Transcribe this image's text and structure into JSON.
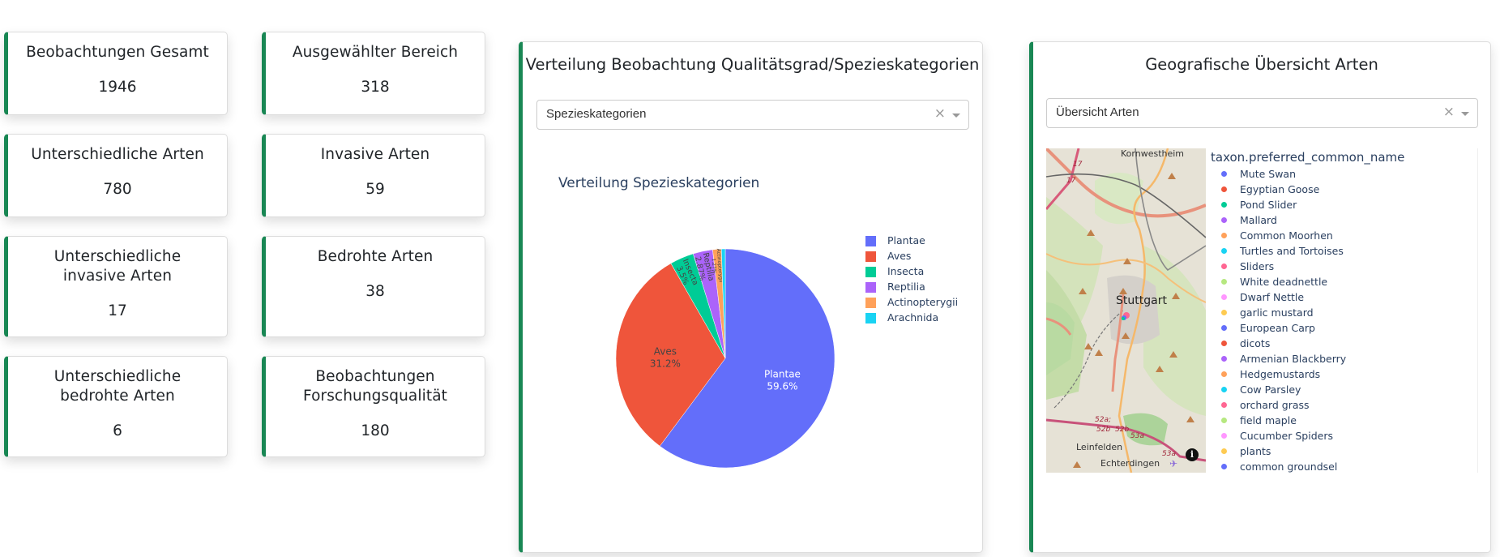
{
  "theme": {
    "accent": "#198754"
  },
  "stats": [
    {
      "title": "Beobachtungen Gesamt",
      "value": "1946"
    },
    {
      "title": "Ausgewählter Bereich",
      "value": "318"
    },
    {
      "title": "Unterschiedliche Arten",
      "value": "780"
    },
    {
      "title": "Invasive Arten",
      "value": "59"
    },
    {
      "title": "Unterschiedliche invasive Arten",
      "value": "17"
    },
    {
      "title": "Bedrohte Arten",
      "value": "38"
    },
    {
      "title": "Unterschiedliche bedrohte Arten",
      "value": "6"
    },
    {
      "title": "Beobachtungen Forschungsqualität",
      "value": "180"
    }
  ],
  "distribution_card": {
    "title": "Verteilung Beobachtung Qualitätsgrad/Spezieskategorien",
    "dropdown": {
      "value": "Spezieskategorien",
      "clear_icon": "×"
    }
  },
  "chart_data": {
    "type": "pie",
    "title": "Verteilung Spezieskategorien",
    "categories": [
      "Plantae",
      "Aves",
      "Insecta",
      "Reptilia",
      "Actinopterygii",
      "Arachnida"
    ],
    "values": [
      59.6,
      31.2,
      3.5,
      2.87,
      1.27,
      0.56
    ],
    "labels": [
      "59.6%",
      "31.2%",
      "3.5%",
      "2.87%",
      "1.27%",
      "0.56%"
    ],
    "colors": [
      "#636efa",
      "#EF553B",
      "#00cc96",
      "#ab63fa",
      "#FFA15A",
      "#19d3f3"
    ],
    "legend_position": "right"
  },
  "geo_card": {
    "title": "Geografische Übersicht Arten",
    "dropdown": {
      "value": "Übersicht Arten",
      "clear_icon": "×"
    },
    "map": {
      "place_labels": [
        "Kornwestheim",
        "Stuttgart",
        "Leinfelden",
        "Echterdingen",
        "17",
        "17",
        "52a;",
        "52b",
        "52b",
        "53a",
        "53a"
      ],
      "info_icon": "i"
    },
    "legend": {
      "title": "taxon.preferred_common_name",
      "items": [
        {
          "name": "Mute Swan",
          "color": "#636efa"
        },
        {
          "name": "Egyptian Goose",
          "color": "#EF553B"
        },
        {
          "name": "Pond Slider",
          "color": "#00cc96"
        },
        {
          "name": "Mallard",
          "color": "#ab63fa"
        },
        {
          "name": "Common Moorhen",
          "color": "#FFA15A"
        },
        {
          "name": "Turtles and Tortoises",
          "color": "#19d3f3"
        },
        {
          "name": "Sliders",
          "color": "#FF6692"
        },
        {
          "name": "White deadnettle",
          "color": "#B6E880"
        },
        {
          "name": "Dwarf Nettle",
          "color": "#FF97FF"
        },
        {
          "name": "garlic mustard",
          "color": "#FECB52"
        },
        {
          "name": "European Carp",
          "color": "#636efa"
        },
        {
          "name": "dicots",
          "color": "#EF553B"
        },
        {
          "name": "Armenian Blackberry",
          "color": "#ab63fa"
        },
        {
          "name": "Hedgemustards",
          "color": "#FFA15A"
        },
        {
          "name": "Cow Parsley",
          "color": "#19d3f3"
        },
        {
          "name": "orchard grass",
          "color": "#FF6692"
        },
        {
          "name": "field maple",
          "color": "#B6E880"
        },
        {
          "name": "Cucumber Spiders",
          "color": "#FF97FF"
        },
        {
          "name": "plants",
          "color": "#FECB52"
        },
        {
          "name": "common groundsel",
          "color": "#636efa"
        }
      ]
    }
  }
}
